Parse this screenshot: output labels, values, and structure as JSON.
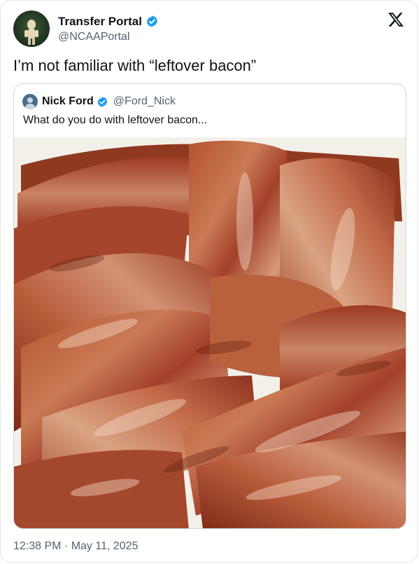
{
  "author": {
    "display_name": "Transfer Portal",
    "handle": "@NCAAPortal"
  },
  "tweet": {
    "text": "I’m not familiar with “leftover bacon”"
  },
  "quoted": {
    "display_name": "Nick Ford",
    "handle": "@Ford_Nick",
    "text": "What do you do with leftover bacon..."
  },
  "meta": {
    "timestamp": "12:38 PM · May 11, 2025"
  },
  "icons": {
    "verified": "verified-badge-icon",
    "platform": "x-logo-icon"
  },
  "colors": {
    "verified_blue": "#1d9bf0",
    "secondary_text": "#536471"
  }
}
